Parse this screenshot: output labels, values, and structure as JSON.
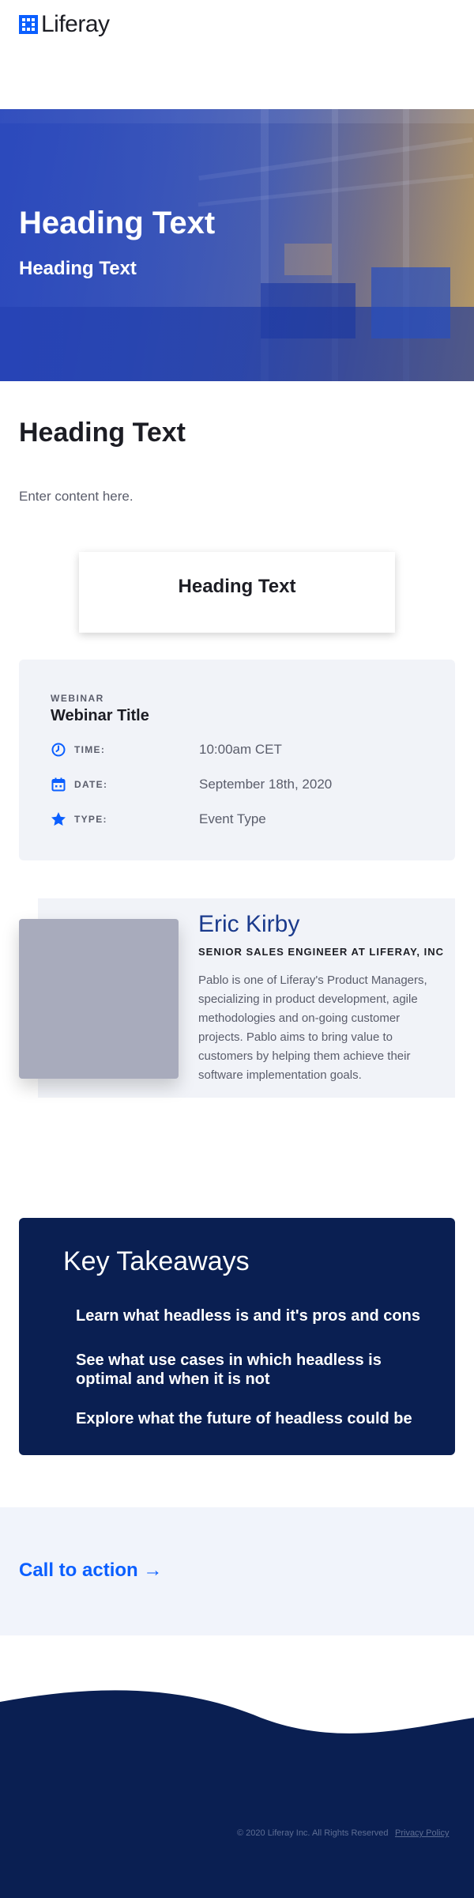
{
  "header": {
    "logo_text": "Liferay"
  },
  "hero": {
    "title": "Heading Text",
    "subtitle": "Heading Text"
  },
  "main": {
    "heading": "Heading Text",
    "content": "Enter content here.",
    "card_heading": "Heading Text"
  },
  "webinar": {
    "kicker": "WEBINAR",
    "title": "Webinar Title",
    "rows": [
      {
        "icon": "clock-icon",
        "label": "TIME:",
        "value": "10:00am CET"
      },
      {
        "icon": "calendar-icon",
        "label": "DATE:",
        "value": "September 18th, 2020"
      },
      {
        "icon": "star-icon",
        "label": "TYPE:",
        "value": "Event Type"
      }
    ]
  },
  "speaker": {
    "name": "Eric Kirby",
    "role": "SENIOR SALES ENGINEER AT LIFERAY, INC",
    "bio": "Pablo is one of Liferay's Product Managers, specializing in product development, agile methodologies and on-going customer projects. Pablo aims to bring value to customers by helping them achieve their software implementation goals."
  },
  "takeaways": {
    "title": "Key Takeaways",
    "items": [
      "Learn what headless is and it's pros and cons",
      "See what use cases in which headless is optimal and when it is not",
      "Explore what the future of headless could be"
    ]
  },
  "cta": {
    "label": "Call to action",
    "arrow": "→"
  },
  "footer": {
    "copyright": "© 2020 Liferay Inc. All Rights Reserved",
    "privacy": "Privacy Policy"
  },
  "colors": {
    "accent": "#0b5fff",
    "navy": "#0a1f52",
    "panel": "#f1f3f8"
  }
}
